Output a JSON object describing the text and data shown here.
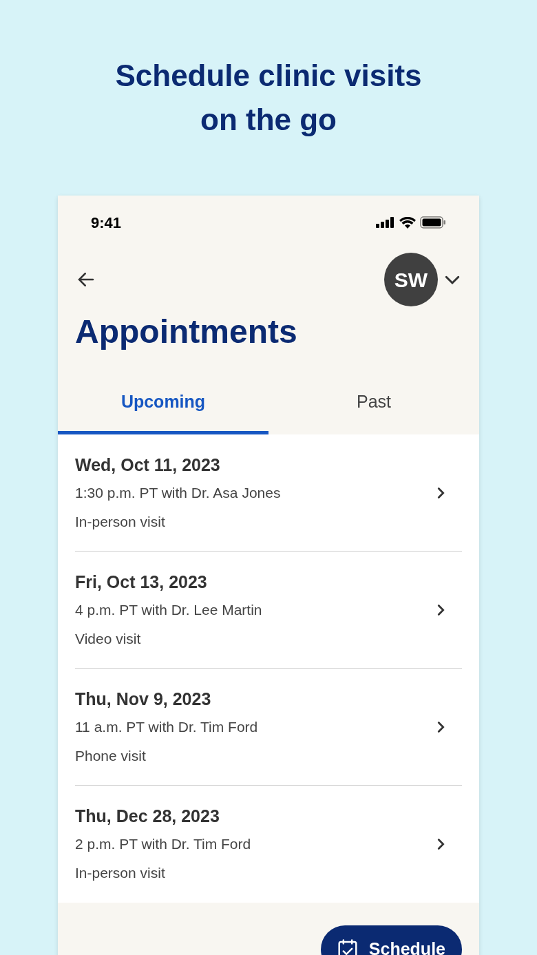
{
  "headline_lines": [
    "Schedule clinic visits",
    "on the go"
  ],
  "status_bar": {
    "time": "9:41"
  },
  "header": {
    "avatar_initials": "SW",
    "title": "Appointments"
  },
  "tabs": [
    {
      "label": "Upcoming",
      "selected": true
    },
    {
      "label": "Past",
      "selected": false
    }
  ],
  "appointments": [
    {
      "date": "Wed, Oct 11, 2023",
      "details": "1:30 p.m. PT with Dr. Asa Jones",
      "visit_type": "In-person visit"
    },
    {
      "date": "Fri, Oct 13, 2023",
      "details": "4 p.m. PT with Dr. Lee Martin",
      "visit_type": "Video visit"
    },
    {
      "date": "Thu, Nov 9, 2023",
      "details": "11 a.m. PT with Dr. Tim Ford",
      "visit_type": "Phone visit"
    },
    {
      "date": "Thu, Dec 28, 2023",
      "details": "2 p.m. PT with Dr. Tim Ford",
      "visit_type": "In-person visit"
    }
  ],
  "schedule_button": {
    "label": "Schedule"
  }
}
